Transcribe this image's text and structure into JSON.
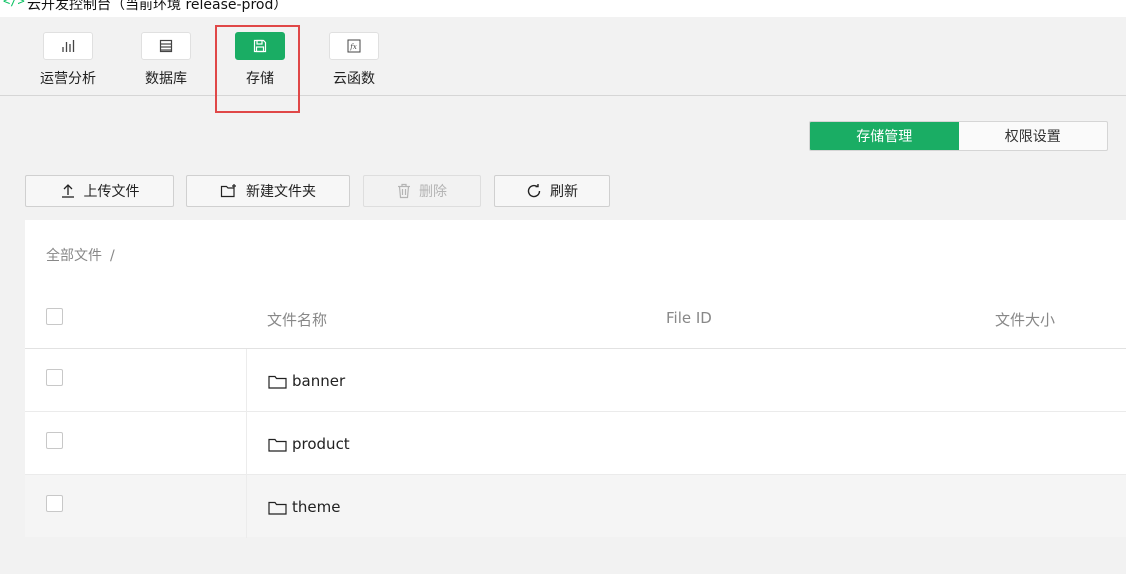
{
  "window": {
    "title": "云开发控制台（当前环境 release-prod）",
    "logo_glyph": "</>"
  },
  "toolbar": {
    "items": [
      {
        "label": "运营分析",
        "icon": "bar-chart-icon",
        "active": false
      },
      {
        "label": "数据库",
        "icon": "database-icon",
        "active": false
      },
      {
        "label": "存储",
        "icon": "save-disk-icon",
        "active": true
      },
      {
        "label": "云函数",
        "icon": "function-fx-icon",
        "active": false
      }
    ]
  },
  "tabs": {
    "storage_manage": "存储管理",
    "permission_settings": "权限设置"
  },
  "actions": {
    "upload": "上传文件",
    "new_folder": "新建文件夹",
    "delete": "删除",
    "refresh": "刷新"
  },
  "breadcrumb": {
    "root": "全部文件",
    "separator": "/"
  },
  "table": {
    "columns": {
      "name": "文件名称",
      "file_id": "File ID",
      "size": "文件大小"
    },
    "rows": [
      {
        "name": "banner",
        "type": "folder"
      },
      {
        "name": "product",
        "type": "folder"
      },
      {
        "name": "theme",
        "type": "folder"
      }
    ]
  },
  "colors": {
    "accent": "#1aad64",
    "highlight": "#e04848"
  }
}
